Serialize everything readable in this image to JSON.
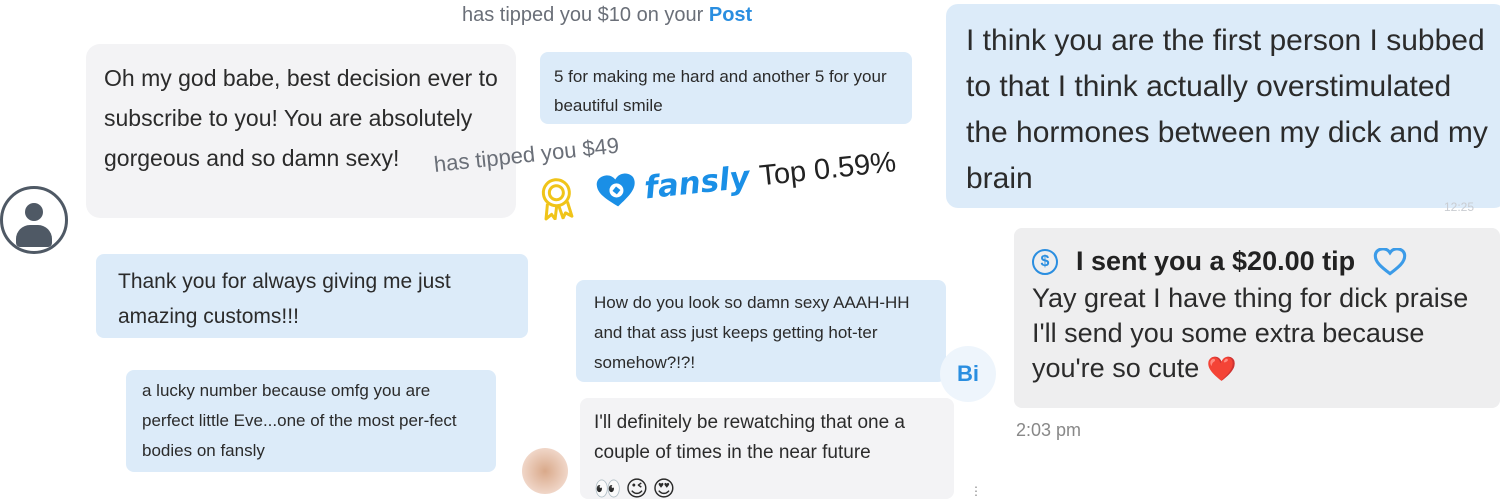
{
  "notices": {
    "tip1_prefix": "has tipped you $10 on your",
    "tip1_link": "Post",
    "tip2": "has tipped you $49"
  },
  "messages": {
    "msg1": "Oh my god babe, best decision ever to subscribe to you! You are absolutely gorgeous and so damn sexy!",
    "msg2": "5 for making me hard and another 5 for your beautiful smile",
    "msg3": "I think you are the first person I subbed to that I think actually overstimulated the hormones between my dick and my brain",
    "msg4": "Thank you for always giving me just amazing customs!!!",
    "msg5": "How do you look so damn sexy AAAH-HH and that ass just keeps getting hot-ter somehow?!?!",
    "msg6": "a lucky number because omfg you are perfect little Eve...one of the most per-fect bodies on fansly",
    "msg7": "I'll definitely be rewatching that one a couple of times in the near future",
    "msg7_emojis": [
      "👀",
      "😉",
      "😍"
    ]
  },
  "tip_message": {
    "tip_label": "I sent you a $20.00 tip",
    "body": "Yay great I have thing for dick praise I'll send you some extra because you're so cute",
    "emoji": "❤️",
    "time": "2:03 pm"
  },
  "badge": {
    "brand": "fansly",
    "rank": "Top 0.59%"
  },
  "avatar_initials": "Bi",
  "colors": {
    "accent": "#1a8fe6",
    "bubble_blue": "#dcebf9",
    "bubble_gray": "#f3f3f5"
  }
}
